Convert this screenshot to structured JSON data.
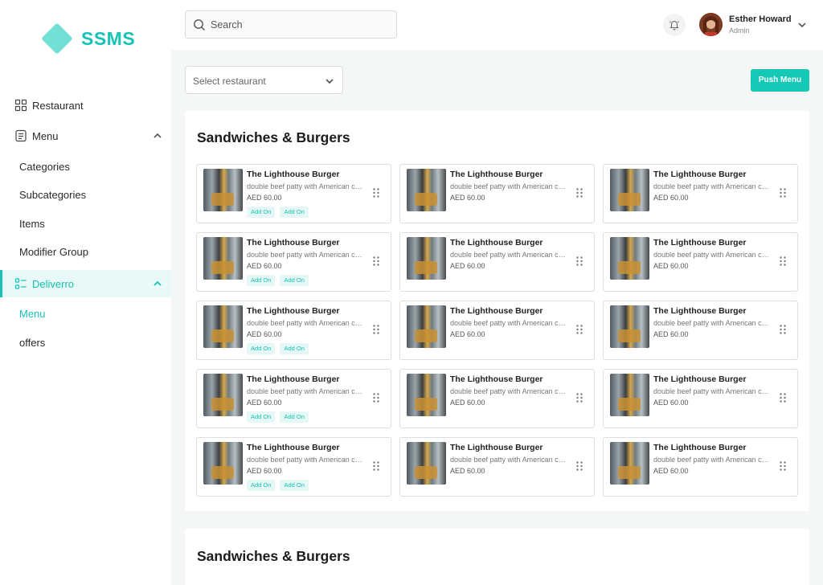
{
  "brand": {
    "name": "SSMS",
    "accent": "#16c3b4"
  },
  "sidebar": {
    "items": [
      {
        "label": "Restaurant",
        "icon": "grid-icon"
      },
      {
        "label": "Menu",
        "icon": "document-icon",
        "sub": [
          "Categories",
          "Subcategories",
          "Items",
          "Modifier Group"
        ]
      },
      {
        "label": "Deliverro",
        "icon": "list-icon",
        "active": true,
        "sub": [
          "Menu",
          "offers"
        ]
      }
    ]
  },
  "topbar": {
    "search_placeholder": "Search",
    "user": {
      "name": "Esther Howard",
      "role": "Admin"
    }
  },
  "toolbar": {
    "restaurant_placeholder": "Select restaurant",
    "push_label": "Push Menu"
  },
  "sections": [
    {
      "title": "Sandwiches & Burgers"
    },
    {
      "title": "Sandwiches & Burgers"
    }
  ],
  "item": {
    "title": "The Lighthouse Burger",
    "description": "double beef patty with American cheese",
    "price": "AED 60.00",
    "tags": [
      "Add On",
      "Add On"
    ]
  }
}
